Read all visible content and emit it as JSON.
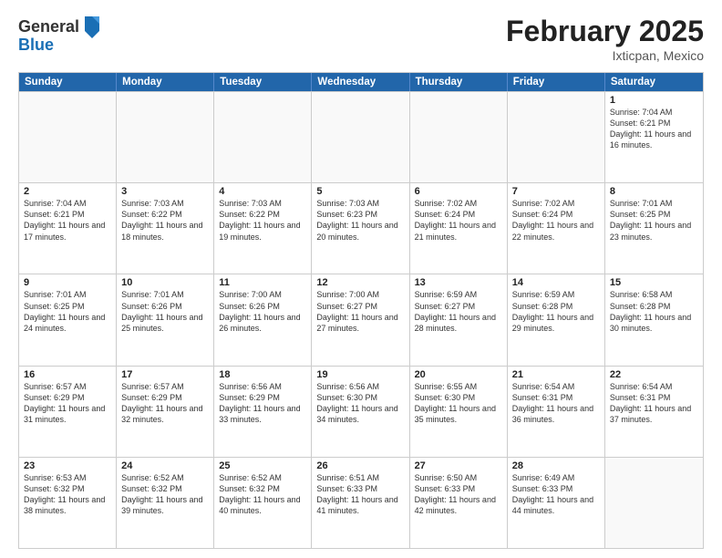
{
  "header": {
    "logo_general": "General",
    "logo_blue": "Blue",
    "month_title": "February 2025",
    "location": "Ixticpan, Mexico"
  },
  "weekdays": [
    "Sunday",
    "Monday",
    "Tuesday",
    "Wednesday",
    "Thursday",
    "Friday",
    "Saturday"
  ],
  "rows": [
    [
      {
        "day": "",
        "text": ""
      },
      {
        "day": "",
        "text": ""
      },
      {
        "day": "",
        "text": ""
      },
      {
        "day": "",
        "text": ""
      },
      {
        "day": "",
        "text": ""
      },
      {
        "day": "",
        "text": ""
      },
      {
        "day": "1",
        "text": "Sunrise: 7:04 AM\nSunset: 6:21 PM\nDaylight: 11 hours and 16 minutes."
      }
    ],
    [
      {
        "day": "2",
        "text": "Sunrise: 7:04 AM\nSunset: 6:21 PM\nDaylight: 11 hours and 17 minutes."
      },
      {
        "day": "3",
        "text": "Sunrise: 7:03 AM\nSunset: 6:22 PM\nDaylight: 11 hours and 18 minutes."
      },
      {
        "day": "4",
        "text": "Sunrise: 7:03 AM\nSunset: 6:22 PM\nDaylight: 11 hours and 19 minutes."
      },
      {
        "day": "5",
        "text": "Sunrise: 7:03 AM\nSunset: 6:23 PM\nDaylight: 11 hours and 20 minutes."
      },
      {
        "day": "6",
        "text": "Sunrise: 7:02 AM\nSunset: 6:24 PM\nDaylight: 11 hours and 21 minutes."
      },
      {
        "day": "7",
        "text": "Sunrise: 7:02 AM\nSunset: 6:24 PM\nDaylight: 11 hours and 22 minutes."
      },
      {
        "day": "8",
        "text": "Sunrise: 7:01 AM\nSunset: 6:25 PM\nDaylight: 11 hours and 23 minutes."
      }
    ],
    [
      {
        "day": "9",
        "text": "Sunrise: 7:01 AM\nSunset: 6:25 PM\nDaylight: 11 hours and 24 minutes."
      },
      {
        "day": "10",
        "text": "Sunrise: 7:01 AM\nSunset: 6:26 PM\nDaylight: 11 hours and 25 minutes."
      },
      {
        "day": "11",
        "text": "Sunrise: 7:00 AM\nSunset: 6:26 PM\nDaylight: 11 hours and 26 minutes."
      },
      {
        "day": "12",
        "text": "Sunrise: 7:00 AM\nSunset: 6:27 PM\nDaylight: 11 hours and 27 minutes."
      },
      {
        "day": "13",
        "text": "Sunrise: 6:59 AM\nSunset: 6:27 PM\nDaylight: 11 hours and 28 minutes."
      },
      {
        "day": "14",
        "text": "Sunrise: 6:59 AM\nSunset: 6:28 PM\nDaylight: 11 hours and 29 minutes."
      },
      {
        "day": "15",
        "text": "Sunrise: 6:58 AM\nSunset: 6:28 PM\nDaylight: 11 hours and 30 minutes."
      }
    ],
    [
      {
        "day": "16",
        "text": "Sunrise: 6:57 AM\nSunset: 6:29 PM\nDaylight: 11 hours and 31 minutes."
      },
      {
        "day": "17",
        "text": "Sunrise: 6:57 AM\nSunset: 6:29 PM\nDaylight: 11 hours and 32 minutes."
      },
      {
        "day": "18",
        "text": "Sunrise: 6:56 AM\nSunset: 6:29 PM\nDaylight: 11 hours and 33 minutes."
      },
      {
        "day": "19",
        "text": "Sunrise: 6:56 AM\nSunset: 6:30 PM\nDaylight: 11 hours and 34 minutes."
      },
      {
        "day": "20",
        "text": "Sunrise: 6:55 AM\nSunset: 6:30 PM\nDaylight: 11 hours and 35 minutes."
      },
      {
        "day": "21",
        "text": "Sunrise: 6:54 AM\nSunset: 6:31 PM\nDaylight: 11 hours and 36 minutes."
      },
      {
        "day": "22",
        "text": "Sunrise: 6:54 AM\nSunset: 6:31 PM\nDaylight: 11 hours and 37 minutes."
      }
    ],
    [
      {
        "day": "23",
        "text": "Sunrise: 6:53 AM\nSunset: 6:32 PM\nDaylight: 11 hours and 38 minutes."
      },
      {
        "day": "24",
        "text": "Sunrise: 6:52 AM\nSunset: 6:32 PM\nDaylight: 11 hours and 39 minutes."
      },
      {
        "day": "25",
        "text": "Sunrise: 6:52 AM\nSunset: 6:32 PM\nDaylight: 11 hours and 40 minutes."
      },
      {
        "day": "26",
        "text": "Sunrise: 6:51 AM\nSunset: 6:33 PM\nDaylight: 11 hours and 41 minutes."
      },
      {
        "day": "27",
        "text": "Sunrise: 6:50 AM\nSunset: 6:33 PM\nDaylight: 11 hours and 42 minutes."
      },
      {
        "day": "28",
        "text": "Sunrise: 6:49 AM\nSunset: 6:33 PM\nDaylight: 11 hours and 44 minutes."
      },
      {
        "day": "",
        "text": ""
      }
    ]
  ]
}
